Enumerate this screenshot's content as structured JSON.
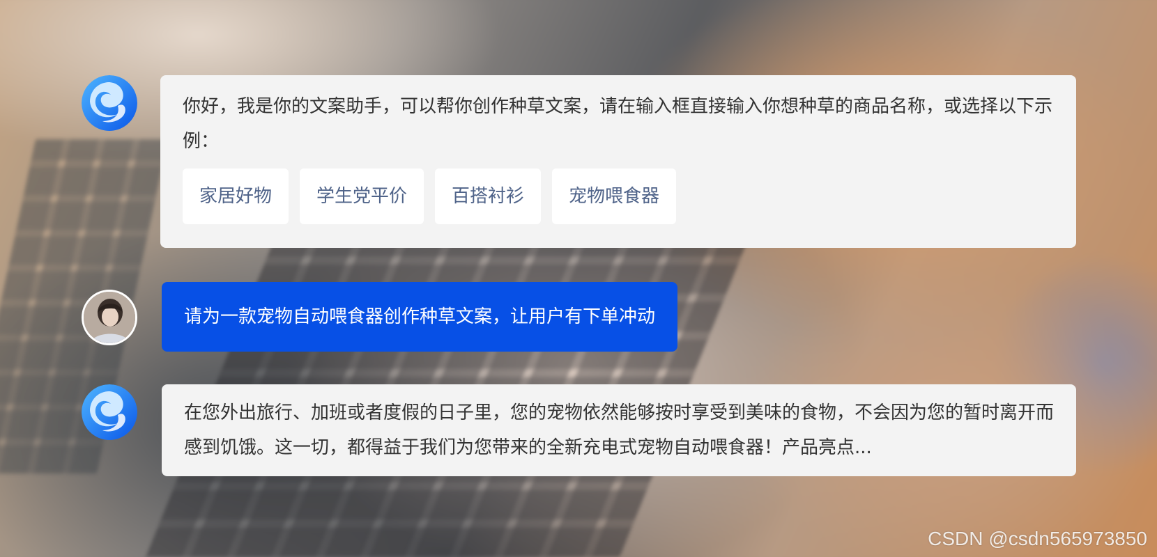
{
  "assistant_intro": {
    "text": "你好，我是你的文案助手，可以帮你创作种草文案，请在输入框直接输入你想种草的商品名称，或选择以下示例：",
    "examples": [
      "家居好物",
      "学生党平价",
      "百搭衬衫",
      "宠物喂食器"
    ]
  },
  "user_message": {
    "text": "请为一款宠物自动喂食器创作种草文案，让用户有下单冲动"
  },
  "assistant_reply": {
    "text": "在您外出旅行、加班或者度假的日子里，您的宠物依然能够按时享受到美味的食物，不会因为您的暂时离开而感到饥饿。这一切，都得益于我们为您带来的全新充电式宠物自动喂食器！产品亮点..."
  },
  "watermark": "CSDN @csdn565973850",
  "colors": {
    "user_bubble": "#0750e6",
    "assistant_bubble": "#f3f3f3",
    "chip_text": "#4f6389"
  },
  "icons": {
    "assistant_avatar": "assistant-logo-icon",
    "user_avatar": "user-avatar-photo"
  }
}
